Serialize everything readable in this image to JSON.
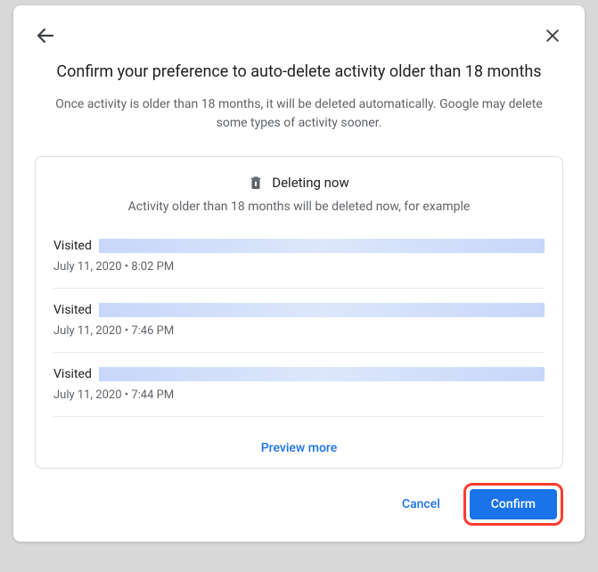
{
  "dialog": {
    "title": "Confirm your preference to auto-delete activity older than 18 months",
    "subtitle": "Once activity is older than 18 months, it will be deleted automatically. Google may delete some types of activity sooner."
  },
  "card": {
    "deleting_label": "Deleting now",
    "subtitle": "Activity older than 18 months will be deleted now, for example",
    "items": [
      {
        "action": "Visited",
        "timestamp": "July 11, 2020 • 8:02 PM"
      },
      {
        "action": "Visited",
        "timestamp": "July 11, 2020 • 7:46 PM"
      },
      {
        "action": "Visited",
        "timestamp": "July 11, 2020 • 7:44 PM"
      }
    ],
    "preview_more": "Preview more"
  },
  "actions": {
    "cancel": "Cancel",
    "confirm": "Confirm"
  }
}
